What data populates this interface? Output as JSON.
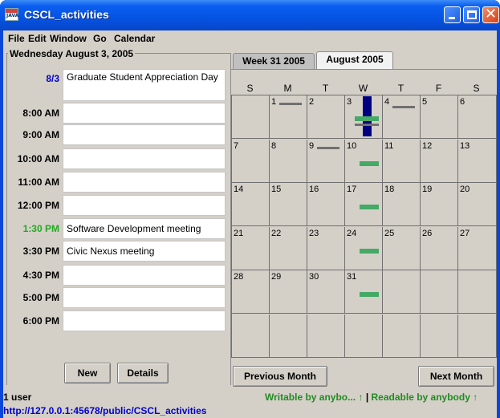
{
  "window": {
    "title": "CSCL_activities",
    "icon_text": "JAVA",
    "title_bar_color": "#0553e2"
  },
  "menu": [
    "File",
    "Edit",
    "Window",
    "Go",
    "Calendar"
  ],
  "day_view": {
    "date_title": "Wednesday August 3, 2005",
    "slots": [
      {
        "time": "8/3",
        "event": "Graduate Student Appreciation Day",
        "time_color": "#0000cc"
      },
      {
        "time": "8:00 AM",
        "event": ""
      },
      {
        "time": "9:00 AM",
        "event": ""
      },
      {
        "time": "10:00 AM",
        "event": ""
      },
      {
        "time": "11:00 AM",
        "event": ""
      },
      {
        "time": "12:00 PM",
        "event": ""
      },
      {
        "time": "1:30 PM",
        "event": "Software Development meeting",
        "time_color": "#22aa22"
      },
      {
        "time": "3:30 PM",
        "event": "Civic Nexus meeting"
      },
      {
        "time": "4:30 PM",
        "event": ""
      },
      {
        "time": "5:00 PM",
        "event": ""
      },
      {
        "time": "6:00 PM",
        "event": ""
      }
    ],
    "buttons": {
      "new": "New",
      "details": "Details"
    }
  },
  "month_view": {
    "tabs": [
      "Week 31 2005",
      "August 2005"
    ],
    "active_tab": 1,
    "weekdays": [
      "S",
      "M",
      "T",
      "W",
      "T",
      "F",
      "S"
    ],
    "weeks": [
      [
        "",
        "1",
        "2",
        "3",
        "4",
        "5",
        "6"
      ],
      [
        "7",
        "8",
        "9",
        "10",
        "11",
        "12",
        "13"
      ],
      [
        "14",
        "15",
        "16",
        "17",
        "18",
        "19",
        "20"
      ],
      [
        "21",
        "22",
        "23",
        "24",
        "25",
        "26",
        "27"
      ],
      [
        "28",
        "29",
        "30",
        "31",
        "",
        "",
        ""
      ],
      [
        "",
        "",
        "",
        "",
        "",
        "",
        ""
      ]
    ],
    "selected_day": "3",
    "event_colors": {
      "selected": "#000080",
      "green": "#44aa66",
      "gray": "#707070"
    },
    "buttons": {
      "prev": "Previous Month",
      "next": "Next Month"
    }
  },
  "status": {
    "users": "1 user",
    "url": "http://127.0.0.1:45678/public/CSCL_activities",
    "writable": "Writable by anybo... ",
    "separator": "|",
    "readable": "Readable by anybody ",
    "arrow": "↑"
  }
}
